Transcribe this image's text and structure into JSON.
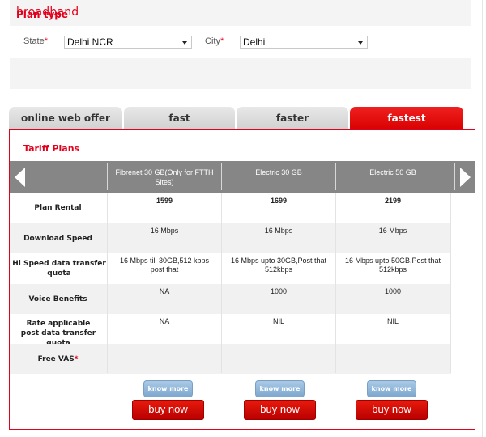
{
  "header": {
    "title": "broadband"
  },
  "filters": {
    "state": {
      "label": "State",
      "required_mark": "*",
      "value": "Delhi NCR"
    },
    "city": {
      "label": "City",
      "required_mark": "*",
      "value": "Delhi"
    }
  },
  "plan_type": {
    "title": "Plan type"
  },
  "tabs": [
    {
      "label": "online web offer",
      "active": false
    },
    {
      "label": "fast",
      "active": false
    },
    {
      "label": "faster",
      "active": false
    },
    {
      "label": "fastest",
      "active": true
    }
  ],
  "tariff": {
    "title": "Tariff Plans",
    "nav": {
      "prev_icon": "arrow-left-icon",
      "next_icon": "arrow-right-icon"
    },
    "plans": [
      {
        "name": "Fibrenet 30 GB(Only for FTTH Sites)"
      },
      {
        "name": "Electric 30 GB"
      },
      {
        "name": "Electric 50 GB"
      }
    ],
    "rows": [
      {
        "label": "Plan Rental",
        "values": [
          "1599",
          "1699",
          "2199"
        ]
      },
      {
        "label": "Download Speed",
        "values": [
          "16 Mbps",
          "16 Mbps",
          "16 Mbps"
        ]
      },
      {
        "label": "Hi Speed data transfer quota",
        "values": [
          "16 Mbps till 30GB,512 kbps post that",
          "16 Mbps upto 30GB,Post that 512kbps",
          "16 Mbps upto 50GB,Post that 512kbps"
        ]
      },
      {
        "label": "Voice Benefits",
        "values": [
          "NA",
          "1000",
          "1000"
        ]
      },
      {
        "label": "Rate applicable post data transfer quota",
        "values": [
          "NA",
          "NIL",
          "NIL"
        ]
      },
      {
        "label": "Free VAS",
        "label_mark": "*",
        "values": [
          "",
          "",
          ""
        ]
      }
    ],
    "know_more_label": "know more",
    "buy_now_label": "buy now"
  },
  "colors": {
    "brand_red": "#e3001b",
    "header_gray": "#868686",
    "know_more_blue": "#8fb5da"
  }
}
